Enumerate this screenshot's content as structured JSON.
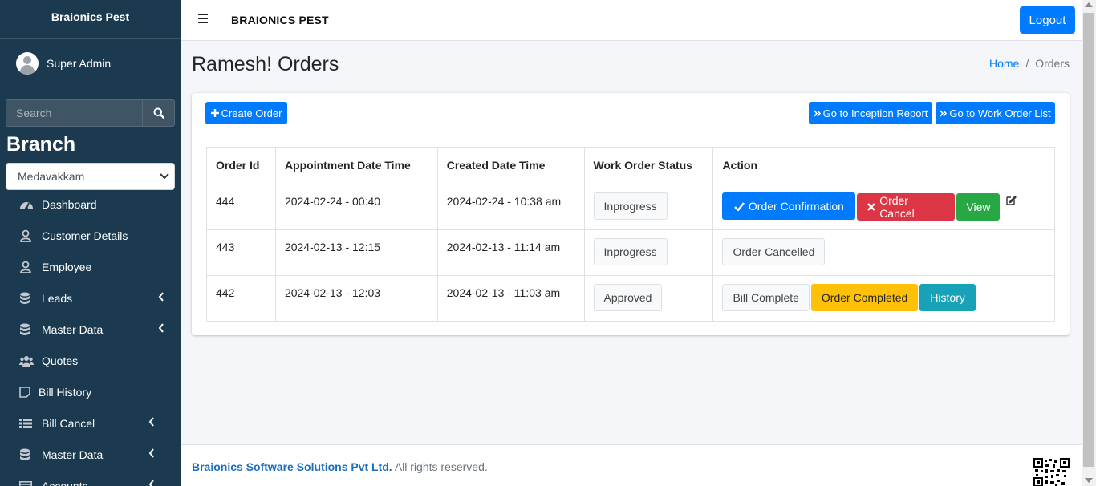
{
  "sidebar": {
    "brand": "Braionics Pest",
    "user_name": "Super Admin",
    "search_placeholder": "Search",
    "branch_title": "Branch",
    "branch_selected": "Medavakkam",
    "items": [
      {
        "label": "Dashboard",
        "icon": "tachometer-icon"
      },
      {
        "label": "Customer Details",
        "icon": "user-icon"
      },
      {
        "label": "Employee",
        "icon": "user-icon"
      },
      {
        "label": "Leads",
        "icon": "database-icon"
      },
      {
        "label": "Master Data",
        "icon": "database-icon"
      },
      {
        "label": "Quotes",
        "icon": "users-icon"
      },
      {
        "label": "Bill History",
        "icon": "sticky-note-icon"
      },
      {
        "label": "Bill Cancel",
        "icon": "list-icon"
      },
      {
        "label": "Master Data",
        "icon": "database-icon"
      },
      {
        "label": "Accounts",
        "icon": "money-icon"
      }
    ]
  },
  "topbar": {
    "title": "BRAIONICS PEST",
    "logout_label": "Logout"
  },
  "page": {
    "title": "Ramesh! Orders",
    "breadcrumb": {
      "home": "Home",
      "separator": "/",
      "current": "Orders"
    }
  },
  "card": {
    "create_label": "Create Order",
    "inception_label": "Go to Inception Report",
    "worklist_label": "Go to Work Order List"
  },
  "table": {
    "headers": [
      "Order Id",
      "Appointment Date Time",
      "Created Date Time",
      "Work Order Status",
      "Action"
    ],
    "rows": [
      {
        "order_id": "444",
        "appointment": "2024-02-24 - 00:40",
        "created": "2024-02-24 - 10:38 am",
        "status": "Inprogress",
        "actions": {
          "confirm": "Order Confirmation",
          "cancel": "Order Cancel",
          "view": "View"
        }
      },
      {
        "order_id": "443",
        "appointment": "2024-02-13 - 12:15",
        "created": "2024-02-13 - 11:14 am",
        "status": "Inprogress",
        "actions": {
          "cancelled": "Order Cancelled"
        }
      },
      {
        "order_id": "442",
        "appointment": "2024-02-13 - 12:03",
        "created": "2024-02-13 - 11:03 am",
        "status": "Approved",
        "actions": {
          "bill": "Bill Complete",
          "completed": "Order Completed",
          "history": "History"
        }
      }
    ]
  },
  "footer": {
    "company": "Braionics Software Solutions Pvt Ltd.",
    "rights": "All rights reserved."
  },
  "colors": {
    "sidebar_bg": "#1c3a4f",
    "primary": "#007bff",
    "danger": "#dc3545",
    "success": "#28a745",
    "warning": "#ffc107",
    "info": "#17a2b8"
  }
}
